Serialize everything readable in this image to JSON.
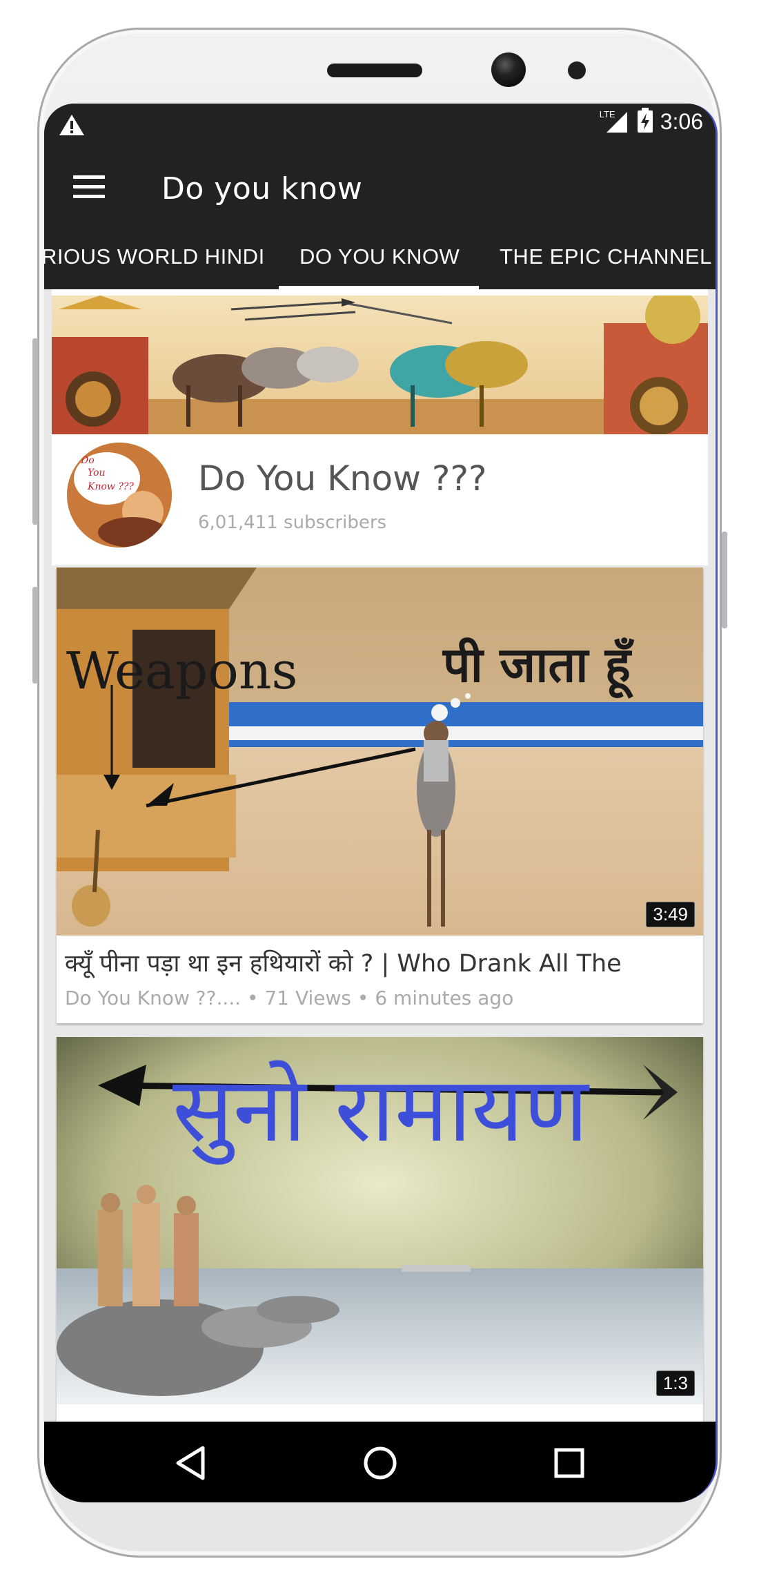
{
  "status_bar": {
    "warning_icon": "warning-icon",
    "network": "LTE",
    "time": "3:06"
  },
  "app_bar": {
    "menu_icon": "hamburger-menu-icon",
    "title": "Do you know"
  },
  "tabs": [
    {
      "label": "RIOUS WORLD HINDI",
      "selected": false
    },
    {
      "label": "DO YOU KNOW",
      "selected": true
    },
    {
      "label": "THE EPIC CHANNEL",
      "selected": false
    }
  ],
  "channel": {
    "name": "Do You Know ???",
    "subscribers": "6,01,411 subscribers",
    "avatar_text": [
      "Do",
      "You",
      "Know ???"
    ]
  },
  "videos": [
    {
      "thumbnail_text_left": "Weapons",
      "thumbnail_text_right": "पी जाता हूँ",
      "duration": "3:49",
      "title": "क्यूँ पीना पड़ा था इन हथियारों को ? | Who Drank All The",
      "meta": "Do You Know ??.... • 71 Views • 6 minutes ago"
    },
    {
      "thumbnail_text": "सुनो रामायण",
      "duration": "1:3"
    }
  ],
  "nav_bar": {
    "back_icon": "back-triangle-icon",
    "home_icon": "home-circle-icon",
    "recents_icon": "recents-square-icon"
  },
  "colors": {
    "app_bar": "#222222",
    "accent_indicator": "#ffffff",
    "nav_bar": "#000000"
  }
}
